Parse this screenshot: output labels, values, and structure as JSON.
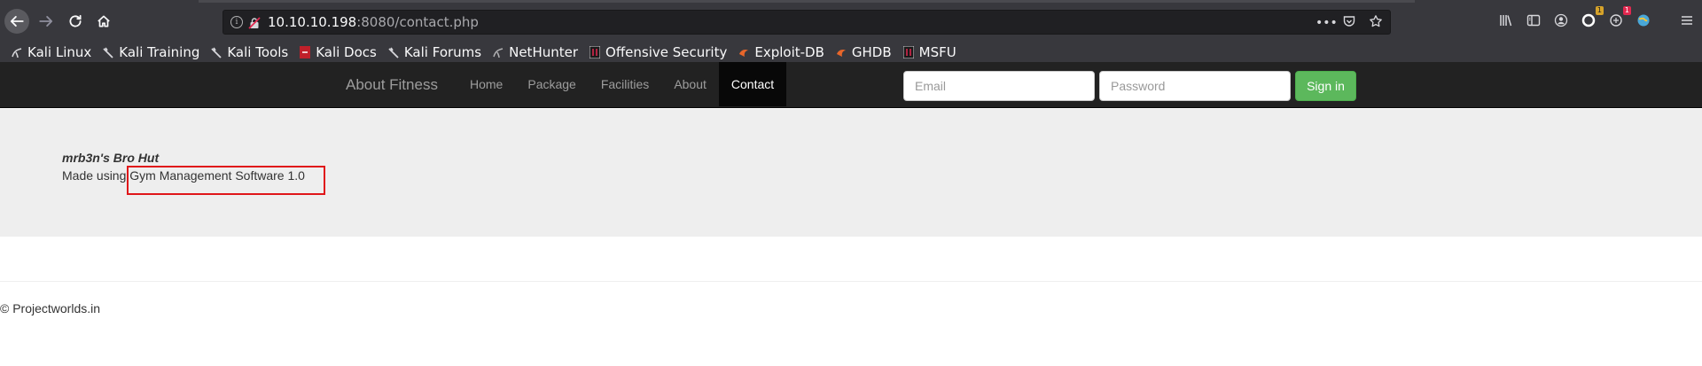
{
  "browser": {
    "url_host": "10.10.10.198",
    "url_rest": ":8080/contact.php",
    "badges": {
      "notifications": "1",
      "extension": "1"
    }
  },
  "bookmarks": [
    {
      "label": "Kali Linux",
      "icon": "kali-dragon-icon"
    },
    {
      "label": "Kali Training",
      "icon": "kali-dragon-icon"
    },
    {
      "label": "Kali Tools",
      "icon": "kali-dragon-icon"
    },
    {
      "label": "Kali Docs",
      "icon": "kali-docs-icon"
    },
    {
      "label": "Kali Forums",
      "icon": "kali-dragon-icon"
    },
    {
      "label": "NetHunter",
      "icon": "nethunter-icon"
    },
    {
      "label": "Offensive Security",
      "icon": "offsec-icon"
    },
    {
      "label": "Exploit-DB",
      "icon": "exploitdb-icon"
    },
    {
      "label": "GHDB",
      "icon": "ghdb-icon"
    },
    {
      "label": "MSFU",
      "icon": "msfu-icon"
    }
  ],
  "site": {
    "brand": "About Fitness",
    "nav": [
      "Home",
      "Package",
      "Facilities",
      "About",
      "Contact"
    ],
    "active_nav": "Contact",
    "email_placeholder": "Email",
    "password_placeholder": "Password",
    "signin_label": "Sign in"
  },
  "content": {
    "title": "mrb3n's Bro Hut",
    "made_using": "Made using ",
    "software": "Gym Management Software 1.0",
    "highlight_color": "#e0161a"
  },
  "footer": {
    "text": "© Projectworlds.in"
  }
}
